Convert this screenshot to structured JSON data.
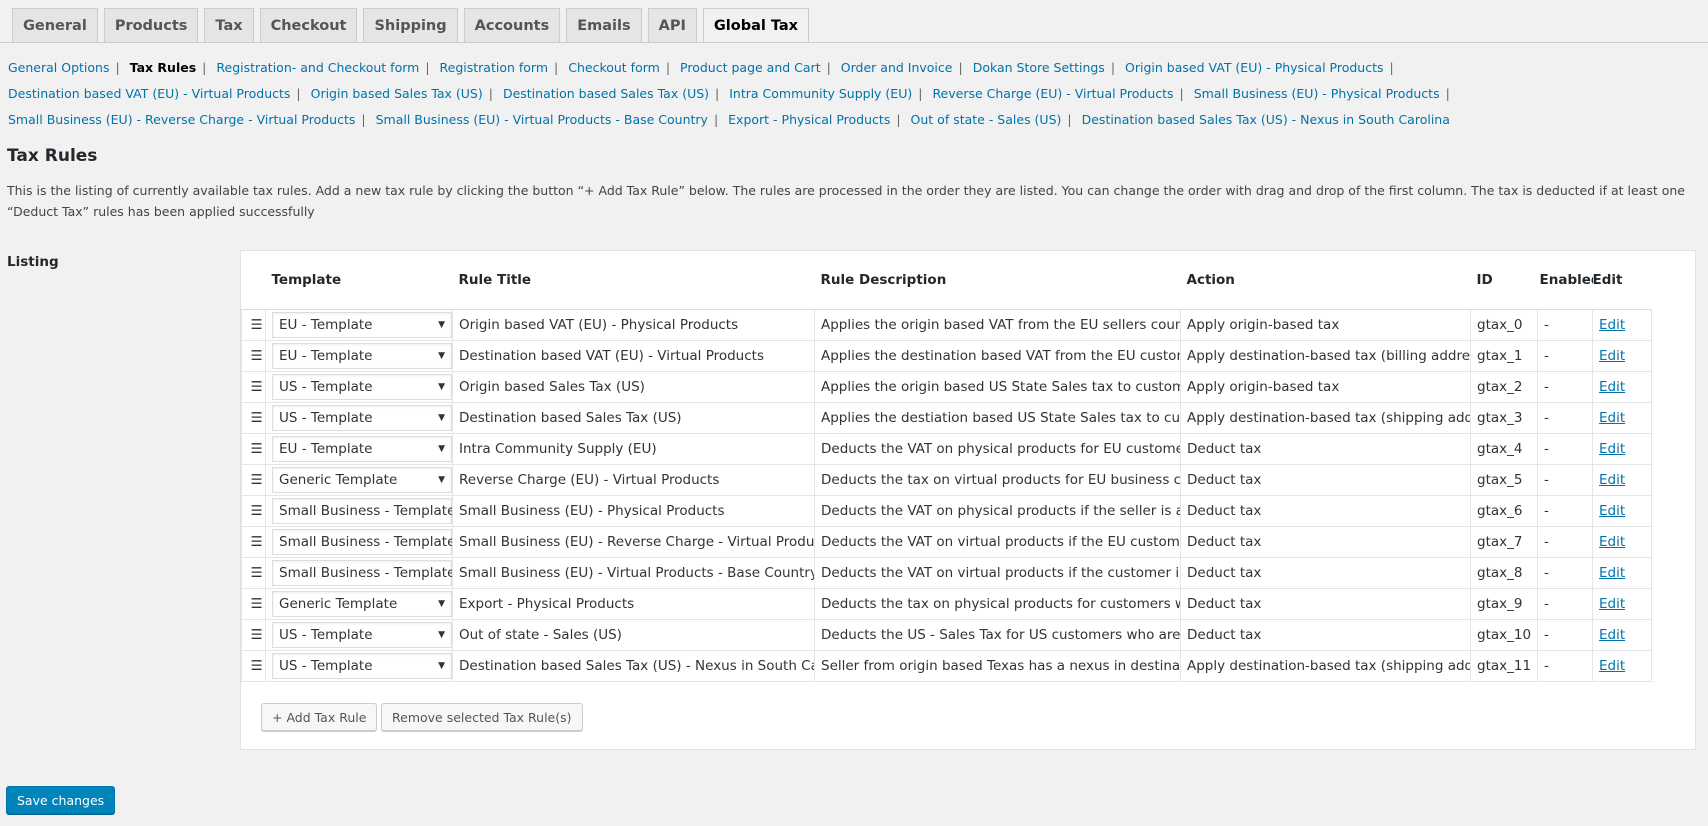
{
  "tabs": [
    {
      "label": "General",
      "active": false
    },
    {
      "label": "Products",
      "active": false
    },
    {
      "label": "Tax",
      "active": false
    },
    {
      "label": "Checkout",
      "active": false
    },
    {
      "label": "Shipping",
      "active": false
    },
    {
      "label": "Accounts",
      "active": false
    },
    {
      "label": "Emails",
      "active": false
    },
    {
      "label": "API",
      "active": false
    },
    {
      "label": "Global Tax",
      "active": true
    }
  ],
  "sublinks": [
    {
      "label": "General Options",
      "current": false
    },
    {
      "label": "Tax Rules",
      "current": true
    },
    {
      "label": "Registration- and Checkout form",
      "current": false
    },
    {
      "label": "Registration form",
      "current": false
    },
    {
      "label": "Checkout form",
      "current": false
    },
    {
      "label": "Product page and Cart",
      "current": false
    },
    {
      "label": "Order and Invoice",
      "current": false
    },
    {
      "label": "Dokan Store Settings",
      "current": false
    },
    {
      "label": "Origin based VAT (EU) - Physical Products",
      "current": false
    },
    {
      "label": "Destination based VAT (EU) - Virtual Products",
      "current": false
    },
    {
      "label": "Origin based Sales Tax (US)",
      "current": false
    },
    {
      "label": "Destination based Sales Tax (US)",
      "current": false
    },
    {
      "label": "Intra Community Supply (EU)",
      "current": false
    },
    {
      "label": "Reverse Charge (EU) - Virtual Products",
      "current": false
    },
    {
      "label": "Small Business (EU) - Physical Products",
      "current": false
    },
    {
      "label": "Small Business (EU) - Reverse Charge - Virtual Products",
      "current": false
    },
    {
      "label": "Small Business (EU) - Virtual Products - Base Country",
      "current": false
    },
    {
      "label": "Export - Physical Products",
      "current": false
    },
    {
      "label": "Out of state - Sales (US)",
      "current": false
    },
    {
      "label": "Destination based Sales Tax (US) - Nexus in South Carolina",
      "current": false
    }
  ],
  "sublink_separator": "|",
  "section": {
    "title": "Tax Rules",
    "description": "This is the listing of currently available tax rules. Add a new tax rule by clicking the button “+ Add Tax Rule” below. The rules are processed in the order they are listed. You can change the order with drag and drop of the first column. The tax is deducted if at least one “Deduct Tax” rules has been applied successfully",
    "listing_label": "Listing"
  },
  "table": {
    "columns": [
      "",
      "Template",
      "Rule Title",
      "Rule Description",
      "Action",
      "ID",
      "Enabled",
      "Edit"
    ],
    "rows": [
      {
        "template": "EU - Template",
        "title": "Origin based VAT (EU) - Physical Products",
        "description": "Applies the origin based VAT from the EU sellers country on",
        "action": "Apply origin-based tax",
        "id": "gtax_0",
        "enabled": "-",
        "edit": "Edit"
      },
      {
        "template": "EU - Template",
        "title": "Destination based VAT (EU) - Virtual Products",
        "description": "Applies the destination based VAT from the EU customers c",
        "action": "Apply destination-based tax (billing addres",
        "id": "gtax_1",
        "enabled": "-",
        "edit": "Edit"
      },
      {
        "template": "US - Template",
        "title": "Origin based Sales Tax (US)",
        "description": "Applies the origin based US State Sales tax to customers fro",
        "action": "Apply origin-based tax",
        "id": "gtax_2",
        "enabled": "-",
        "edit": "Edit"
      },
      {
        "template": "US - Template",
        "title": "Destination based Sales Tax (US)",
        "description": "Applies the destiation based US State Sales tax to customer",
        "action": "Apply destination-based tax (shipping addr",
        "id": "gtax_3",
        "enabled": "-",
        "edit": "Edit"
      },
      {
        "template": "EU - Template",
        "title": "Intra Community Supply (EU)",
        "description": "Deducts the VAT on physical products for EU customers wh",
        "action": "Deduct tax",
        "id": "gtax_4",
        "enabled": "-",
        "edit": "Edit"
      },
      {
        "template": "Generic Template",
        "title": "Reverse Charge (EU) - Virtual Products",
        "description": "Deducts the tax on virtual products for EU business custom",
        "action": "Deduct tax",
        "id": "gtax_5",
        "enabled": "-",
        "edit": "Edit"
      },
      {
        "template": "Small Business - Template",
        "title": "Small Business (EU) - Physical Products",
        "description": "Deducts the VAT on physical products if the seller is an sma",
        "action": "Deduct tax",
        "id": "gtax_6",
        "enabled": "-",
        "edit": "Edit"
      },
      {
        "template": "Small Business - Template",
        "title": "Small Business (EU) - Reverse Charge - Virtual Product",
        "description": "Deducts the VAT on virtual products if the EU customer pro",
        "action": "Deduct tax",
        "id": "gtax_7",
        "enabled": "-",
        "edit": "Edit"
      },
      {
        "template": "Small Business - Template",
        "title": "Small Business (EU) - Virtual Products - Base Country",
        "description": "Deducts the VAT on virtual products if the customer is from",
        "action": "Deduct tax",
        "id": "gtax_8",
        "enabled": "-",
        "edit": "Edit"
      },
      {
        "template": "Generic Template",
        "title": "Export - Physical Products",
        "description": "Deducts the tax on physical products for customers who ar",
        "action": "Deduct tax",
        "id": "gtax_9",
        "enabled": "-",
        "edit": "Edit"
      },
      {
        "template": "US - Template",
        "title": "Out of state - Sales (US)",
        "description": "Deducts the US - Sales Tax for US customers who are from",
        "action": "Deduct tax",
        "id": "gtax_10",
        "enabled": "-",
        "edit": "Edit"
      },
      {
        "template": "US - Template",
        "title": "Destination based Sales Tax (US) - Nexus in South Car",
        "description": "Seller from origin based Texas has a nexus in destination ba",
        "action": "Apply destination-based tax (shipping addr",
        "id": "gtax_11",
        "enabled": "-",
        "edit": "Edit"
      }
    ]
  },
  "buttons": {
    "add_rule": "+ Add Tax Rule",
    "remove_selected": "Remove selected Tax Rule(s)",
    "save": "Save changes"
  },
  "icons": {
    "drag_handle": "hamburger-drag-icon",
    "select_arrow": "triangle-down-icon"
  },
  "colors": {
    "link": "#0073aa",
    "primary_button": "#0085ba",
    "background": "#f1f1f1"
  }
}
